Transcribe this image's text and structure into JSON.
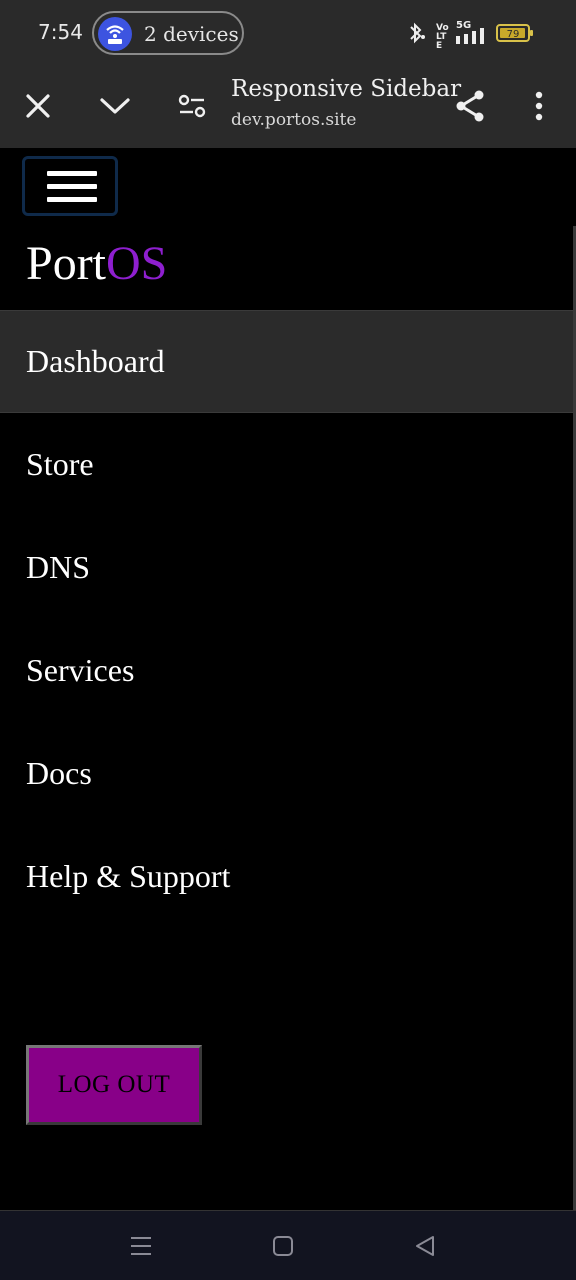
{
  "status_bar": {
    "time": "7:54",
    "hotspot_label": "2 devices",
    "battery_level": "79",
    "network": "5G",
    "volte": "Vo LTE"
  },
  "toolbar": {
    "title": "Responsive Sidebar",
    "url": "dev.portos.site"
  },
  "brand": {
    "prefix": "Port",
    "accent": "OS",
    "accent_color": "#8e1fcf"
  },
  "nav": {
    "items": [
      {
        "label": "Dashboard",
        "active": true
      },
      {
        "label": "Store"
      },
      {
        "label": "DNS"
      },
      {
        "label": "Services"
      },
      {
        "label": "Docs"
      },
      {
        "label": "Help & Support"
      }
    ]
  },
  "logout": {
    "label": "LOG OUT",
    "color": "#880088"
  },
  "icons": {
    "close": "close-icon",
    "chevron": "chevron-down-icon",
    "tune": "tune-icon",
    "share": "share-icon",
    "more": "more-vert-icon",
    "menu": "hamburger-icon"
  }
}
